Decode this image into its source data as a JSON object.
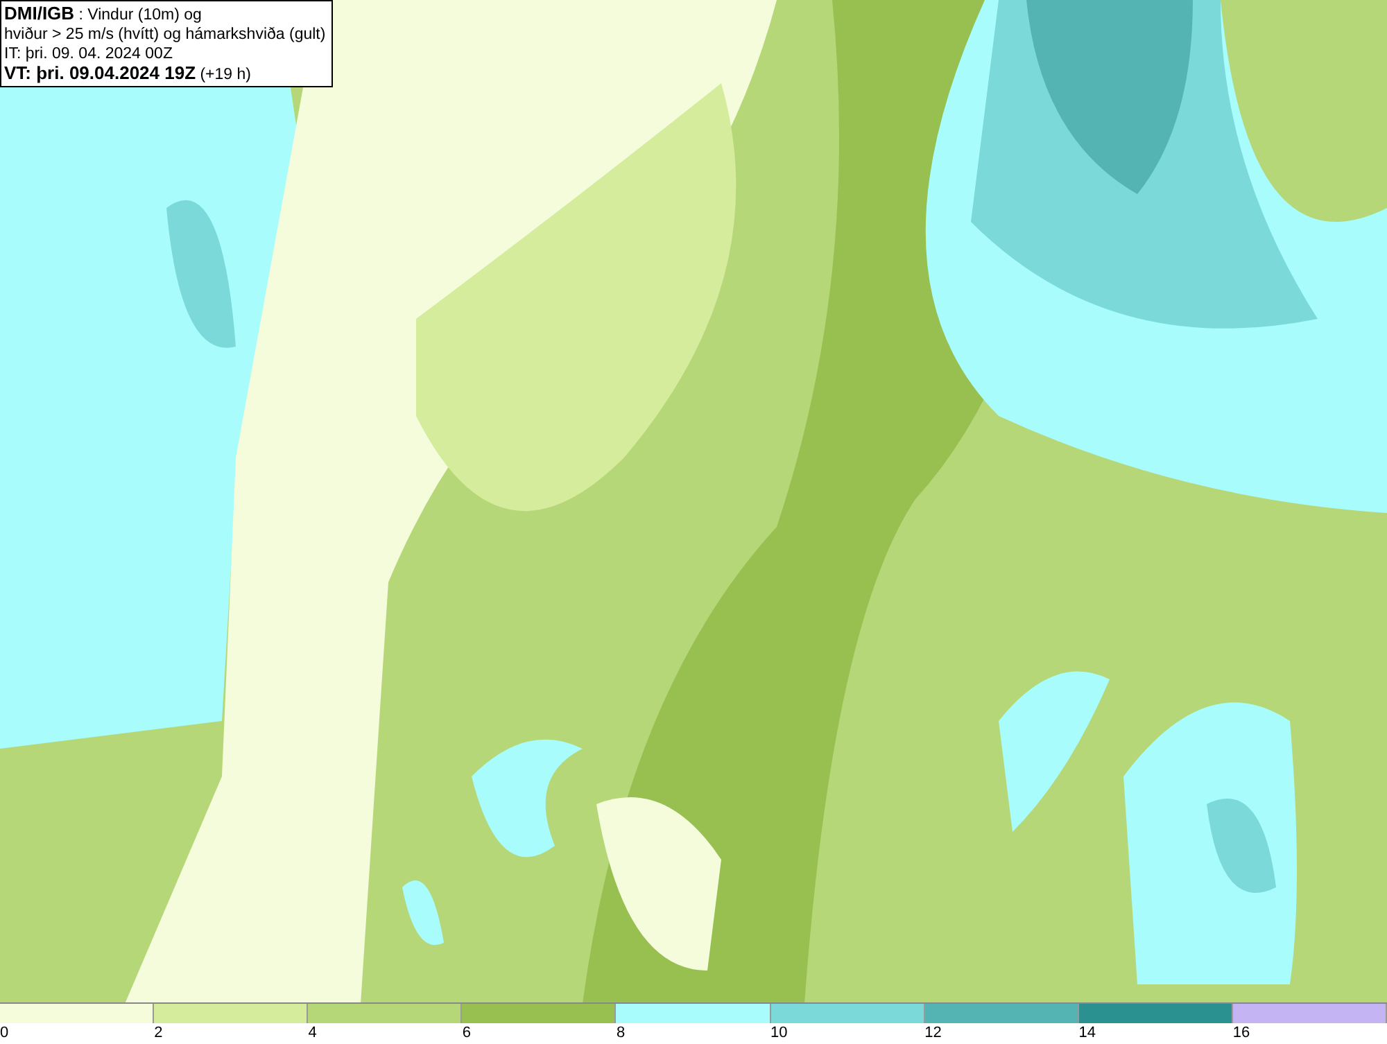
{
  "info_box": {
    "lines": [
      "**DMI/IGB** : Vindur (10m) og",
      "hviður > 25 m/s (hvítt) og hámarkshviða (gult)",
      "IT: þri. 09. 04. 2024 00Z",
      "**VT: þri. 09.04.2024 19Z** (+19 h)"
    ]
  },
  "legend": {
    "bins": [
      {
        "color": "#f5fcdc"
      },
      {
        "color": "#d4ec9c"
      },
      {
        "color": "#b6d777"
      },
      {
        "color": "#98c050"
      },
      {
        "color": "#a8fcfc"
      },
      {
        "color": "#7cd9d9"
      },
      {
        "color": "#54b4b4"
      },
      {
        "color": "#2a9090"
      },
      {
        "color": "#c4b4f4"
      }
    ],
    "ticks": [
      "0",
      "2",
      "4",
      "6",
      "8",
      "10",
      "12",
      "14",
      "16"
    ]
  }
}
